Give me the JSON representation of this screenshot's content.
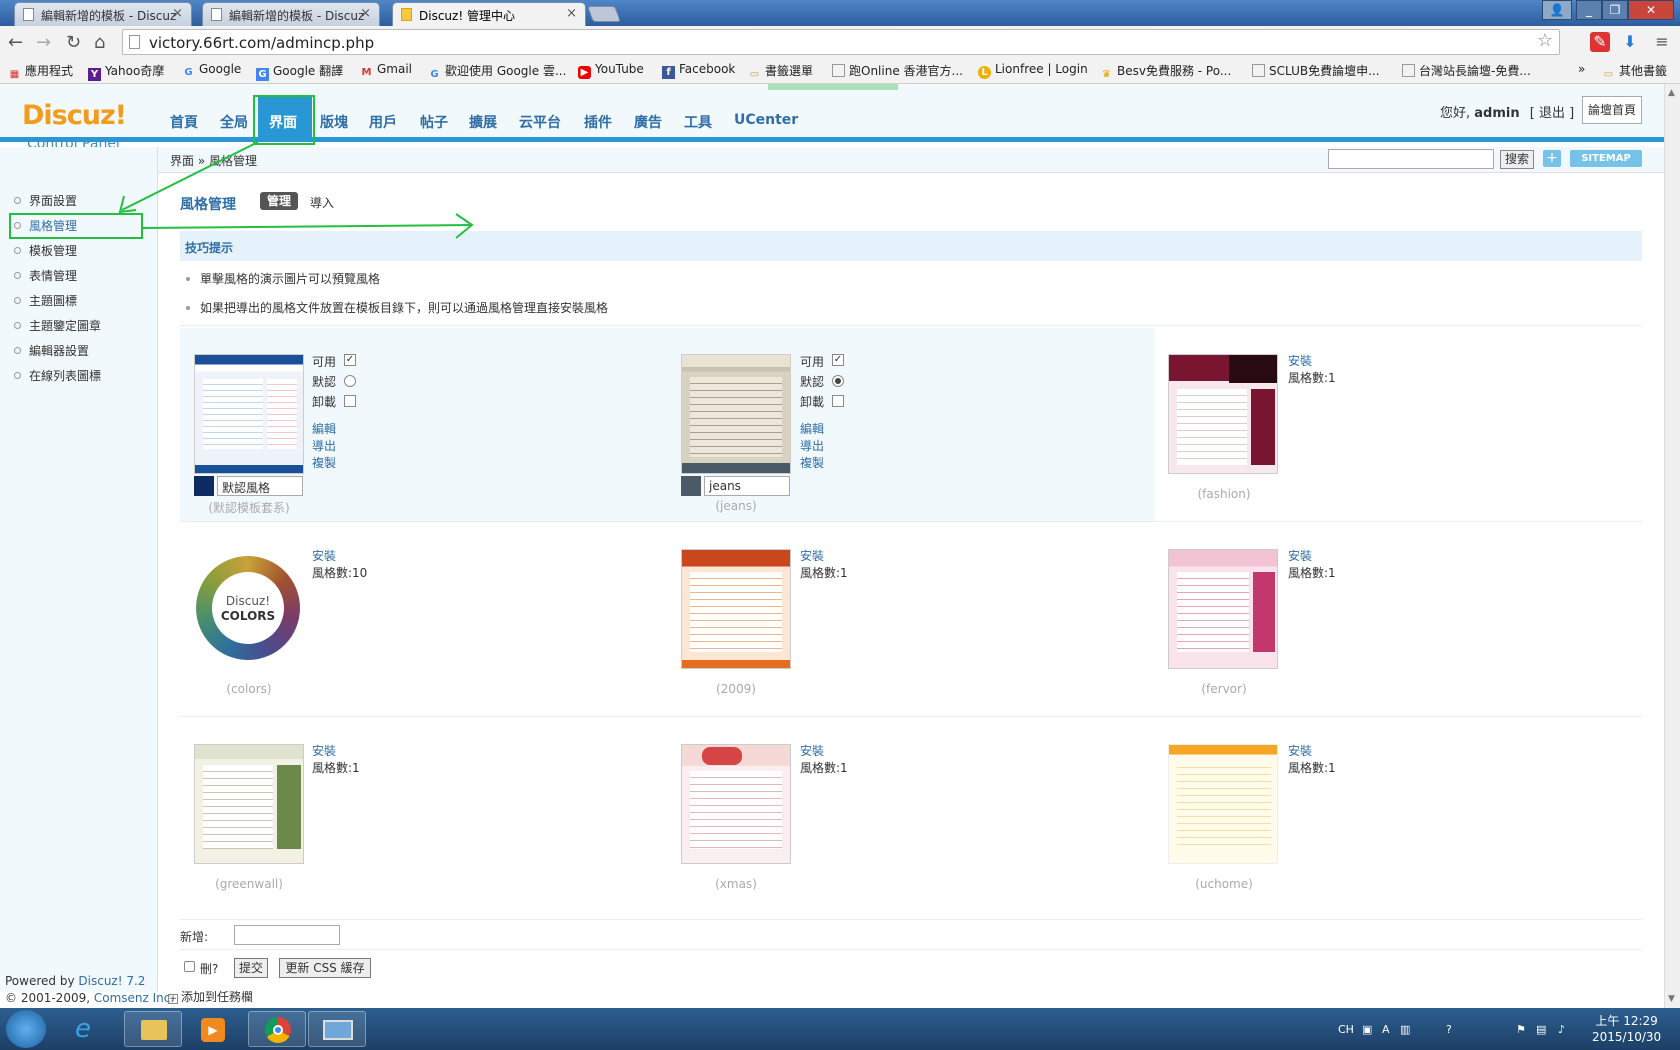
{
  "browser": {
    "tabs": [
      {
        "label": "編輯新增的模板 - Discuz",
        "active": false
      },
      {
        "label": "編輯新增的模板 - Discuz",
        "active": false
      },
      {
        "label": "Discuz! 管理中心",
        "active": true
      }
    ],
    "url": "victory.66rt.com/admincp.php",
    "bookmarks": [
      "應用程式",
      "Yahoo奇摩",
      "Google",
      "Google 翻譯",
      "Gmail",
      "歡迎使用 Google 雲...",
      "YouTube",
      "Facebook",
      "書籤選單",
      "跑Online 香港官方...",
      "Lionfree | Login",
      "Besv免費服務 - Po...",
      "SCLUB免費論壇申...",
      "台灣站長論壇-免費..."
    ],
    "other_bookmarks": "其他書籤",
    "more": "»"
  },
  "header": {
    "logo": "Discuz!",
    "logo_sub": "Control Panel",
    "nav": [
      "首頁",
      "全局",
      "界面",
      "版塊",
      "用戶",
      "帖子",
      "擴展",
      "云平台",
      "插件",
      "廣告",
      "工具",
      "UCenter"
    ],
    "active_nav": "界面",
    "greeting_prefix": "您好,",
    "user": "admin",
    "logout": "[ 退出 ]",
    "home_button": "論壇首頁"
  },
  "sidebar": {
    "items": [
      "界面設置",
      "風格管理",
      "模板管理",
      "表情管理",
      "主題圖標",
      "主題鑒定圖章",
      "編輯器設置",
      "在線列表圖標"
    ],
    "active": "風格管理"
  },
  "breadcrumb": "界面 » 風格管理",
  "search": {
    "button": "搜索",
    "plus": "+",
    "sitemap": "SITEMAP"
  },
  "page": {
    "title": "風格管理",
    "tab_manage": "管理",
    "tab_import": "導入",
    "tips_title": "技巧提示",
    "tips": [
      "單擊風格的演示圖片可以預覽風格",
      "如果把導出的風格文件放置在模板目錄下，則可以通過風格管理直接安裝風格"
    ]
  },
  "styles_installed": [
    {
      "name_value": "默認風格",
      "caption": "(默認模板套系)",
      "labels": [
        "可用",
        "默認",
        "卸載"
      ],
      "links": [
        "編輯",
        "導出",
        "複製"
      ],
      "default": false,
      "swatch": "#0d2a63"
    },
    {
      "name_value": "jeans",
      "caption": "(jeans)",
      "labels": [
        "可用",
        "默認",
        "卸載"
      ],
      "links": [
        "編輯",
        "導出",
        "複製"
      ],
      "default": true,
      "swatch": "#4a5a66"
    }
  ],
  "styles_available": [
    {
      "caption": "(fashion)",
      "install": "安裝",
      "count": "風格數:1"
    },
    {
      "caption": "(colors)",
      "install": "安裝",
      "count": "風格數:10",
      "ring_text_1": "Discuz!",
      "ring_text_2": "COLORS"
    },
    {
      "caption": "(2009)",
      "install": "安裝",
      "count": "風格數:1"
    },
    {
      "caption": "(fervor)",
      "install": "安裝",
      "count": "風格數:1"
    },
    {
      "caption": "(greenwall)",
      "install": "安裝",
      "count": "風格數:1"
    },
    {
      "caption": "(xmas)",
      "install": "安裝",
      "count": "風格數:1"
    },
    {
      "caption": "(uchome)",
      "install": "安裝",
      "count": "風格數:1"
    }
  ],
  "form": {
    "new_label": "新增:",
    "delete_label": "刪?",
    "submit": "提交",
    "update_css": "更新 CSS 緩存"
  },
  "footer": {
    "powered_prefix": "Powered by",
    "powered_link": "Discuz! 7.2",
    "copyright_prefix": "© 2001-2009,",
    "copyright_link": "Comsenz Inc.",
    "add_fav": "添加到任務欄"
  },
  "taskbar": {
    "time": "上午 12:29",
    "date": "2015/10/30",
    "lang": "CH"
  },
  "colors": {
    "accent": "#2a97d5",
    "link": "#2f6ea7",
    "annotation": "#22c040"
  }
}
